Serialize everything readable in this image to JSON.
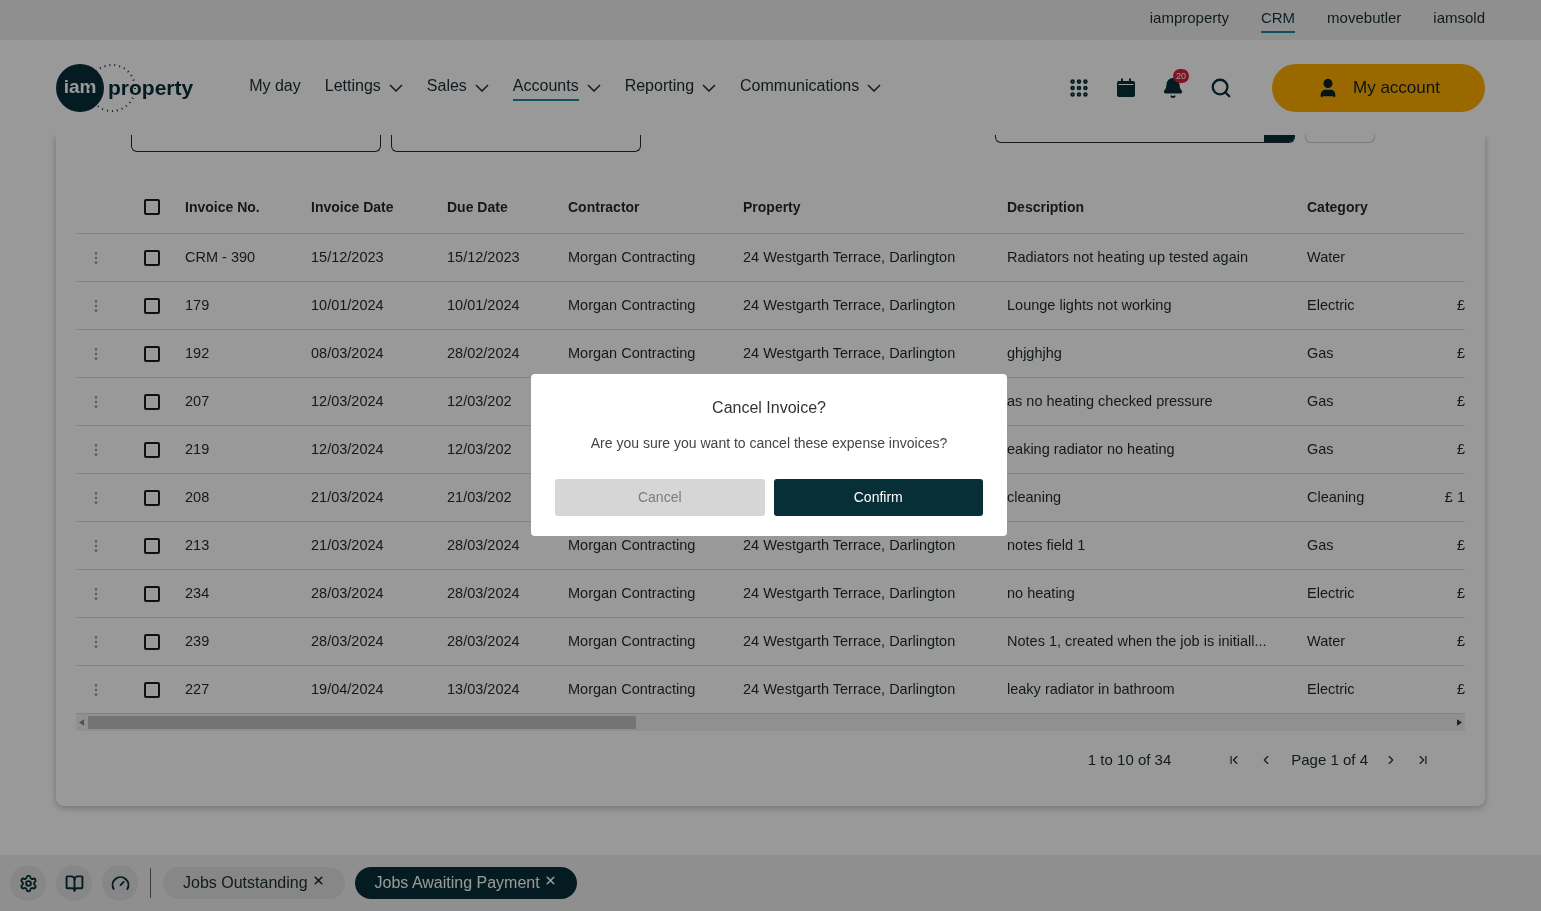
{
  "top_links": [
    {
      "label": "iamproperty",
      "selected": false
    },
    {
      "label": "CRM",
      "selected": true
    },
    {
      "label": "movebutler",
      "selected": false
    },
    {
      "label": "iamsold",
      "selected": false
    }
  ],
  "logo": {
    "mark": "iam",
    "word": "property"
  },
  "nav": [
    {
      "label": "My day",
      "dropdown": false,
      "selected": false
    },
    {
      "label": "Lettings",
      "dropdown": true,
      "selected": false
    },
    {
      "label": "Sales",
      "dropdown": true,
      "selected": false
    },
    {
      "label": "Accounts",
      "dropdown": true,
      "selected": true
    },
    {
      "label": "Reporting",
      "dropdown": true,
      "selected": false
    },
    {
      "label": "Communications",
      "dropdown": true,
      "selected": false
    }
  ],
  "notifications": {
    "count": "20"
  },
  "account_button": "My account",
  "table": {
    "header_checkbox": {
      "checked": false
    },
    "columns": [
      "Invoice No.",
      "Invoice Date",
      "Due Date",
      "Contractor",
      "Property",
      "Description",
      "Category"
    ],
    "rows": [
      {
        "checked": false,
        "invoice_no": "CRM - 390",
        "invoice_date": "15/12/2023",
        "due_date": "15/12/2023",
        "contractor": "Morgan Contracting",
        "property": "24 Westgarth Terrace, Darlington",
        "description": "Radiators not heating up tested again",
        "category": "Water"
      },
      {
        "checked": false,
        "invoice_no": "179",
        "invoice_date": "10/01/2024",
        "due_date": "10/01/2024",
        "contractor": "Morgan Contracting",
        "property": "24 Westgarth Terrace, Darlington",
        "description": "Lounge lights not working",
        "category": "Electric",
        "column_8": "£"
      },
      {
        "checked": false,
        "invoice_no": "192",
        "invoice_date": "08/03/2024",
        "due_date": "28/02/2024",
        "contractor": "Morgan Contracting",
        "property": "24 Westgarth Terrace, Darlington",
        "description": "ghjghjhg",
        "category": "Gas",
        "column_8": "£"
      },
      {
        "checked": false,
        "invoice_no": "207",
        "invoice_date": "12/03/2024",
        "due_date": "12/03/202",
        "description": "as no heating checked pressure",
        "category": "Gas",
        "column_8": "£"
      },
      {
        "checked": false,
        "invoice_no": "219",
        "invoice_date": "12/03/2024",
        "due_date": "12/03/202",
        "description": "eaking radiator no heating",
        "category": "Gas",
        "column_8": "£"
      },
      {
        "checked": false,
        "invoice_no": "208",
        "invoice_date": "21/03/2024",
        "due_date": "21/03/202",
        "description": "cleaning",
        "category": "Cleaning",
        "column_8": "£ 1"
      },
      {
        "checked": false,
        "invoice_no": "213",
        "invoice_date": "21/03/2024",
        "due_date": "28/03/2024",
        "contractor": "Morgan Contracting",
        "property": "24 Westgarth Terrace, Darlington",
        "description": "notes field 1",
        "category": "Gas",
        "column_8": "£"
      },
      {
        "checked": false,
        "invoice_no": "234",
        "invoice_date": "28/03/2024",
        "due_date": "28/03/2024",
        "contractor": "Morgan Contracting",
        "property": "24 Westgarth Terrace, Darlington",
        "description": "no heating",
        "category": "Electric",
        "column_8": "£"
      },
      {
        "checked": false,
        "invoice_no": "239",
        "invoice_date": "28/03/2024",
        "due_date": "28/03/2024",
        "contractor": "Morgan Contracting",
        "property": "24 Westgarth Terrace, Darlington",
        "description": "Notes 1, created when the job is initiall...",
        "category": "Water",
        "column_8": "£"
      },
      {
        "checked": false,
        "invoice_no": "227",
        "invoice_date": "19/04/2024",
        "due_date": "13/03/2024",
        "contractor": "Morgan Contracting",
        "property": "24 Westgarth Terrace, Darlington",
        "description": "leaky radiator in bathroom",
        "category": "Electric",
        "column_8": "£"
      }
    ]
  },
  "pagination": {
    "range": "1 to 10 of 34",
    "page": "Page 1 of 4"
  },
  "dock_tabs": [
    {
      "label": "Jobs Outstanding",
      "selected": false
    },
    {
      "label": "Jobs Awaiting Payment",
      "selected": true
    }
  ],
  "modal": {
    "title": "Cancel Invoice?",
    "message": "Are you sure you want to cancel these expense invoices?",
    "cancel": {
      "label": "Cancel",
      "disabled": true
    },
    "confirm": {
      "label": "Confirm"
    }
  }
}
